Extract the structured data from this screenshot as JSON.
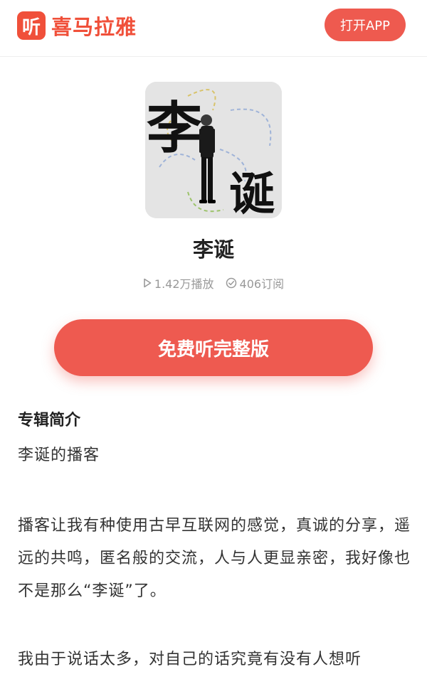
{
  "header": {
    "logo_mark": "听",
    "logo_text": "喜马拉雅",
    "open_app_label": "打开APP"
  },
  "album": {
    "cover_text_top": "李",
    "cover_text_bottom": "诞",
    "title": "李诞",
    "plays": "1.42万播放",
    "subscriptions": "406订阅"
  },
  "cta": {
    "label": "免费听完整版"
  },
  "intro": {
    "heading": "专辑简介",
    "paragraphs": [
      "李诞的播客",
      "播客让我有种使用古早互联网的感觉，真诚的分享，遥远的共鸣，匿名般的交流，人与人更显亲密，我好像也不是那么“李诞”了。",
      "我由于说话太多，对自己的话究竟有没有人想听"
    ]
  },
  "colors": {
    "accent": "#ee5a50",
    "brand": "#f0503a"
  }
}
